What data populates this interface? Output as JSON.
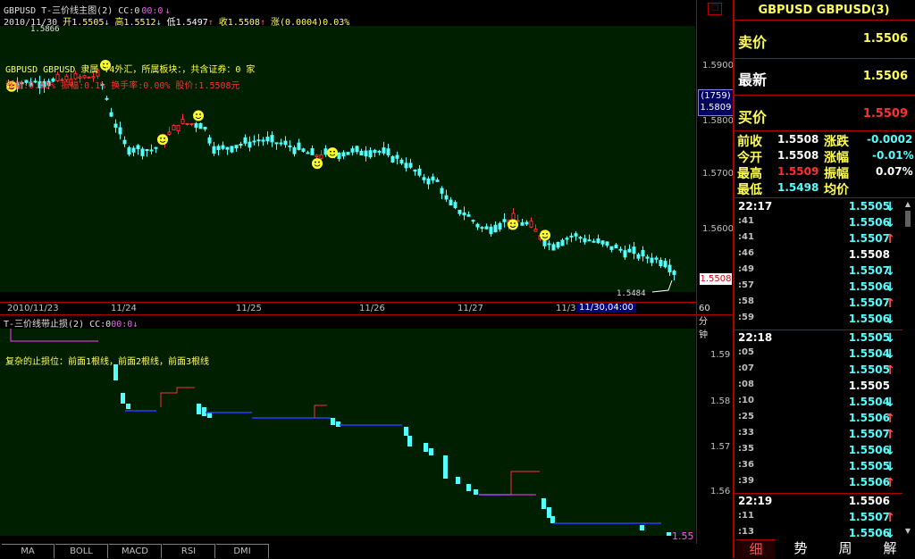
{
  "header": {
    "title": "GBPUSD T-三价线主图(2) CC:0",
    "cc_extra": "00:0",
    "date": "2010/11/30",
    "open_label": "开1.5505",
    "high_label": "高1.5512",
    "low_label": "低1.5497",
    "close_label": "收1.5508",
    "change_label": "涨(0.0004)0.03%",
    "last_high_label": "1.5866"
  },
  "main_chart": {
    "info_line1": "GBPUSD GBPUSD 隶属 T4外汇，所属板块：，共含证券：0 家",
    "info_line2": "涨幅:0.03% 振幅:0.1%  换手率:0.00% 股价:1.5508元",
    "last_low_label": "1.5484",
    "y_ticks": [
      "1.5900",
      "1.5800",
      "1.5700",
      "1.5600"
    ],
    "box_count": "(1759)",
    "box_price": "1.5809",
    "current_price_tag": "1.5508",
    "x_ticks": [
      "2010/11/23",
      "11/24",
      "11/25",
      "11/26",
      "11/27",
      "11/3"
    ],
    "cursor_label": "11/30,04:00",
    "period_label": "60分钟"
  },
  "sub_chart": {
    "title": "T-三价线带止损(2) CC:0",
    "cc_extra": "00:0",
    "description": "复杂的止损位：前面1根线，前面2根线，前面3根线",
    "y_ticks": [
      "1.59",
      "1.58",
      "1.57",
      "1.56"
    ],
    "right_price_label": "1.55"
  },
  "bottom_tabs": [
    "MA",
    "BOLL",
    "MACD",
    "RSI",
    "DMI"
  ],
  "quote_panel": {
    "symbol": "GBPUSD GBPUSD(3)",
    "sell_label": "卖价",
    "sell_value": "1.5506",
    "last_label": "最新",
    "last_value": "1.5506",
    "buy_label": "买价",
    "buy_value": "1.5509",
    "prev_close_label": "前收",
    "prev_close_value": "1.5508",
    "change_label": "涨跌",
    "change_value": "-0.0002",
    "open_label": "今开",
    "open_value": "1.5508",
    "pct_label": "涨幅",
    "pct_value": "-0.01%",
    "high_label": "最高",
    "high_value": "1.5509",
    "amp_label": "振幅",
    "amp_value": "0.07%",
    "low_label": "最低",
    "low_value": "1.5498",
    "avg_label": "均价",
    "avg_value": ""
  },
  "ticks": [
    {
      "time": "22:17",
      "price": "1.5505",
      "dir": "down"
    },
    {
      "time": ":41",
      "price": "1.5506",
      "dir": "down"
    },
    {
      "time": ":41",
      "price": "1.5507",
      "dir": "up"
    },
    {
      "time": ":46",
      "price": "1.5508",
      "dir": "none"
    },
    {
      "time": ":49",
      "price": "1.5507",
      "dir": "down"
    },
    {
      "time": ":57",
      "price": "1.5506",
      "dir": "down"
    },
    {
      "time": ":58",
      "price": "1.5507",
      "dir": "up"
    },
    {
      "time": ":59",
      "price": "1.5506",
      "dir": "down"
    },
    {
      "time": "22:18",
      "price": "1.5505",
      "dir": "down"
    },
    {
      "time": ":05",
      "price": "1.5504",
      "dir": "down"
    },
    {
      "time": ":07",
      "price": "1.5505",
      "dir": "up"
    },
    {
      "time": ":08",
      "price": "1.5505",
      "dir": "none"
    },
    {
      "time": ":10",
      "price": "1.5504",
      "dir": "down"
    },
    {
      "time": ":25",
      "price": "1.5506",
      "dir": "up"
    },
    {
      "time": ":33",
      "price": "1.5507",
      "dir": "up"
    },
    {
      "time": ":35",
      "price": "1.5506",
      "dir": "down"
    },
    {
      "time": ":36",
      "price": "1.5505",
      "dir": "down"
    },
    {
      "time": ":39",
      "price": "1.5506",
      "dir": "up"
    },
    {
      "time": "22:19",
      "price": "1.5506",
      "dir": "none"
    },
    {
      "time": ":11",
      "price": "1.5507",
      "dir": "up"
    },
    {
      "time": ":13",
      "price": "1.5506",
      "dir": "down"
    }
  ],
  "right_tabs": [
    "细",
    "势",
    "周",
    "解"
  ],
  "colors": {
    "bull": "#ff3030",
    "bear": "#55ffff",
    "stop_line": "#2040ff",
    "bg_chart": "#001e00",
    "frame": "#b00000"
  }
}
